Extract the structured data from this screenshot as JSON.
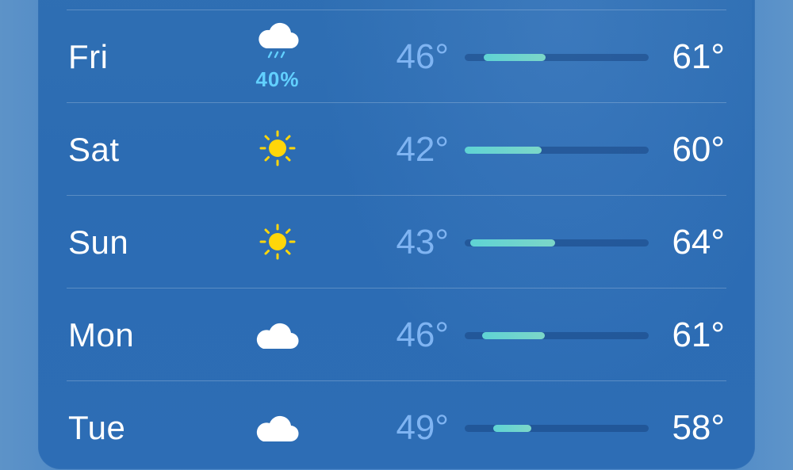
{
  "forecast": {
    "scale": {
      "min": 30,
      "max": 80
    },
    "days": [
      {
        "day": "Fri",
        "icon": "cloud-rain-icon",
        "precip": "40%",
        "low": "46°",
        "high": "61°",
        "range_start": 0.103,
        "range_end": 0.44
      },
      {
        "day": "Sat",
        "icon": "sun-icon",
        "precip": "",
        "low": "42°",
        "high": "60°",
        "range_start": 0.0,
        "range_end": 0.418
      },
      {
        "day": "Sun",
        "icon": "sun-icon",
        "precip": "",
        "low": "43°",
        "high": "64°",
        "range_start": 0.03,
        "range_end": 0.492
      },
      {
        "day": "Mon",
        "icon": "cloud-icon",
        "precip": "",
        "low": "46°",
        "high": "61°",
        "range_start": 0.095,
        "range_end": 0.435
      },
      {
        "day": "Tue",
        "icon": "cloud-icon",
        "precip": "",
        "low": "49°",
        "high": "58°",
        "range_start": 0.155,
        "range_end": 0.362
      }
    ]
  },
  "colors": {
    "background": "#4a86c8",
    "panel": "#2d6db5",
    "low_temp": "#7fb4f2",
    "high_temp": "#ffffff",
    "precip": "#62d0ff",
    "sun": "#ffd60a",
    "bar_fill": "#5fd3d4"
  }
}
